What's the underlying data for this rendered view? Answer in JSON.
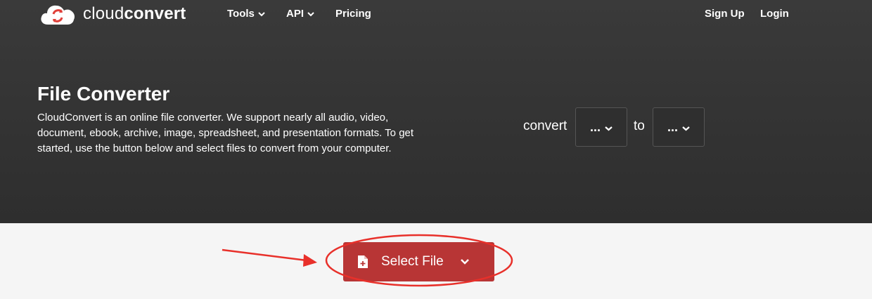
{
  "brand": {
    "name_light": "cloud",
    "name_bold": "convert"
  },
  "nav": {
    "tools": "Tools",
    "api": "API",
    "pricing": "Pricing",
    "signup": "Sign Up",
    "login": "Login"
  },
  "hero": {
    "title": "File Converter",
    "description": "CloudConvert is an online file converter. We support nearly all audio, video, document, ebook, archive, image, spreadsheet, and presentation formats. To get started, use the button below and select files to convert from your computer."
  },
  "converter": {
    "convert_label": "convert",
    "from_value": "...",
    "to_label": "to",
    "to_value": "..."
  },
  "upload": {
    "select_file_label": "Select File"
  },
  "colors": {
    "hero_bg": "#333333",
    "button_red": "#b83535",
    "annotation_red": "#e8302a",
    "page_bg": "#f5f5f5"
  }
}
